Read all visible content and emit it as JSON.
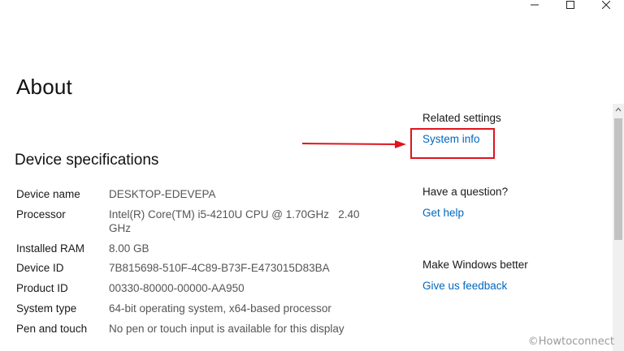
{
  "window": {
    "minimize_icon": "minimize-icon",
    "maximize_icon": "maximize-icon",
    "close_icon": "close-icon"
  },
  "page": {
    "title": "About"
  },
  "device_specs": {
    "title": "Device specifications",
    "rows": [
      {
        "label": "Device name",
        "value": "DESKTOP-EDEVEPA"
      },
      {
        "label": "Processor",
        "value": "Intel(R) Core(TM) i5-4210U CPU @ 1.70GHz   2.40 GHz"
      },
      {
        "label": "Installed RAM",
        "value": "8.00 GB"
      },
      {
        "label": "Device ID",
        "value": "7B815698-510F-4C89-B73F-E473015D83BA"
      },
      {
        "label": "Product ID",
        "value": "00330-80000-00000-AA950"
      },
      {
        "label": "System type",
        "value": "64-bit operating system, x64-based processor"
      },
      {
        "label": "Pen and touch",
        "value": "No pen or touch input is available for this display"
      }
    ]
  },
  "related_settings": {
    "heading": "Related settings",
    "link": "System info"
  },
  "question": {
    "heading": "Have a question?",
    "link": "Get help"
  },
  "feedback": {
    "heading": "Make Windows better",
    "link": "Give us feedback"
  },
  "watermark": "©Howtoconnect",
  "colors": {
    "link": "#0067c0",
    "highlight": "#e0141e",
    "background": "#ffffff"
  }
}
